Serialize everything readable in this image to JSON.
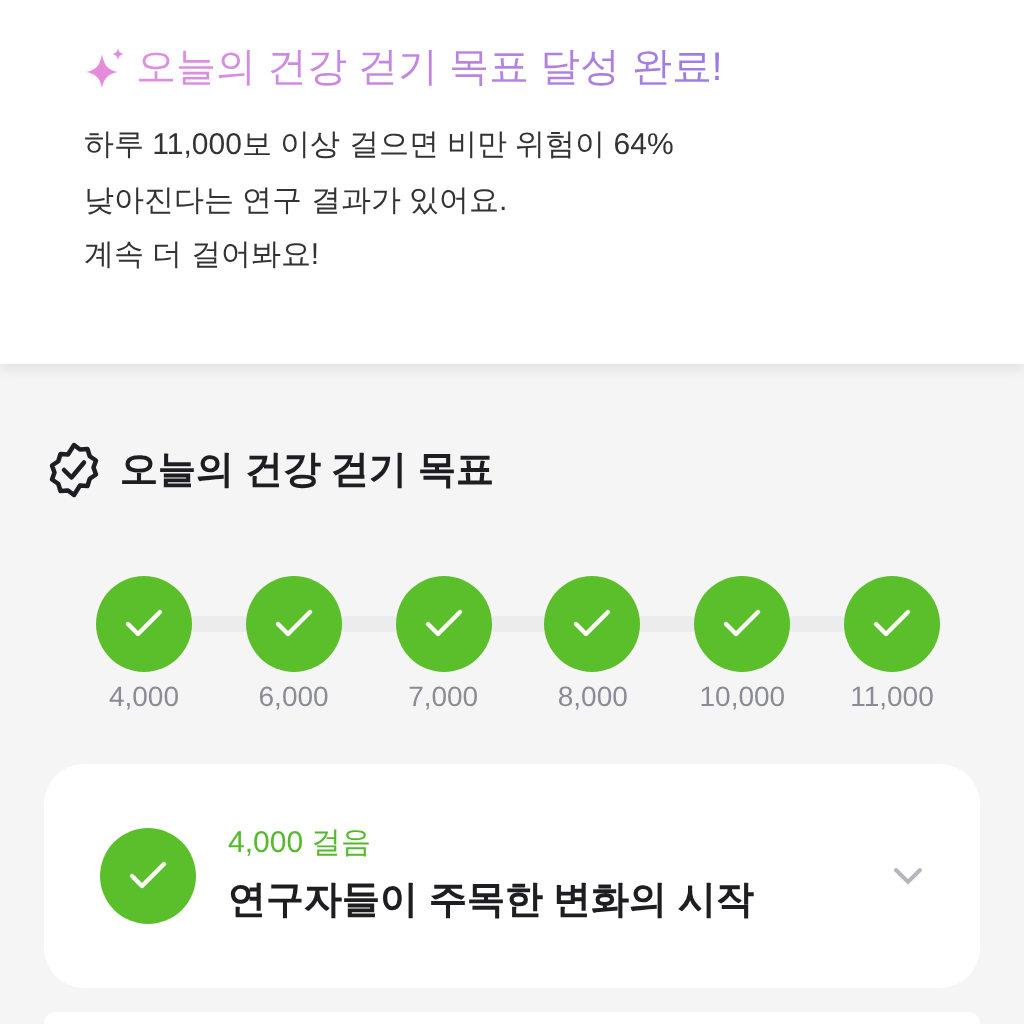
{
  "banner": {
    "title": "오늘의 건강 걷기 목표 달성 완료!",
    "lines": [
      "하루 11,000보 이상 걸으면 비만 위험이 64%",
      "낮아진다는 연구 결과가 있어요.",
      "계속 더 걸어봐요!"
    ]
  },
  "goal": {
    "title": "오늘의 건강 걷기 목표",
    "milestones": [
      {
        "label": "4,000",
        "completed": true
      },
      {
        "label": "6,000",
        "completed": true
      },
      {
        "label": "7,000",
        "completed": true
      },
      {
        "label": "8,000",
        "completed": true
      },
      {
        "label": "10,000",
        "completed": true
      },
      {
        "label": "11,000",
        "completed": true
      }
    ]
  },
  "cards": [
    {
      "steps": "4,000 걸음",
      "title": "연구자들이 주목한 변화의 시작",
      "completed": true,
      "expanded": false
    }
  ]
}
